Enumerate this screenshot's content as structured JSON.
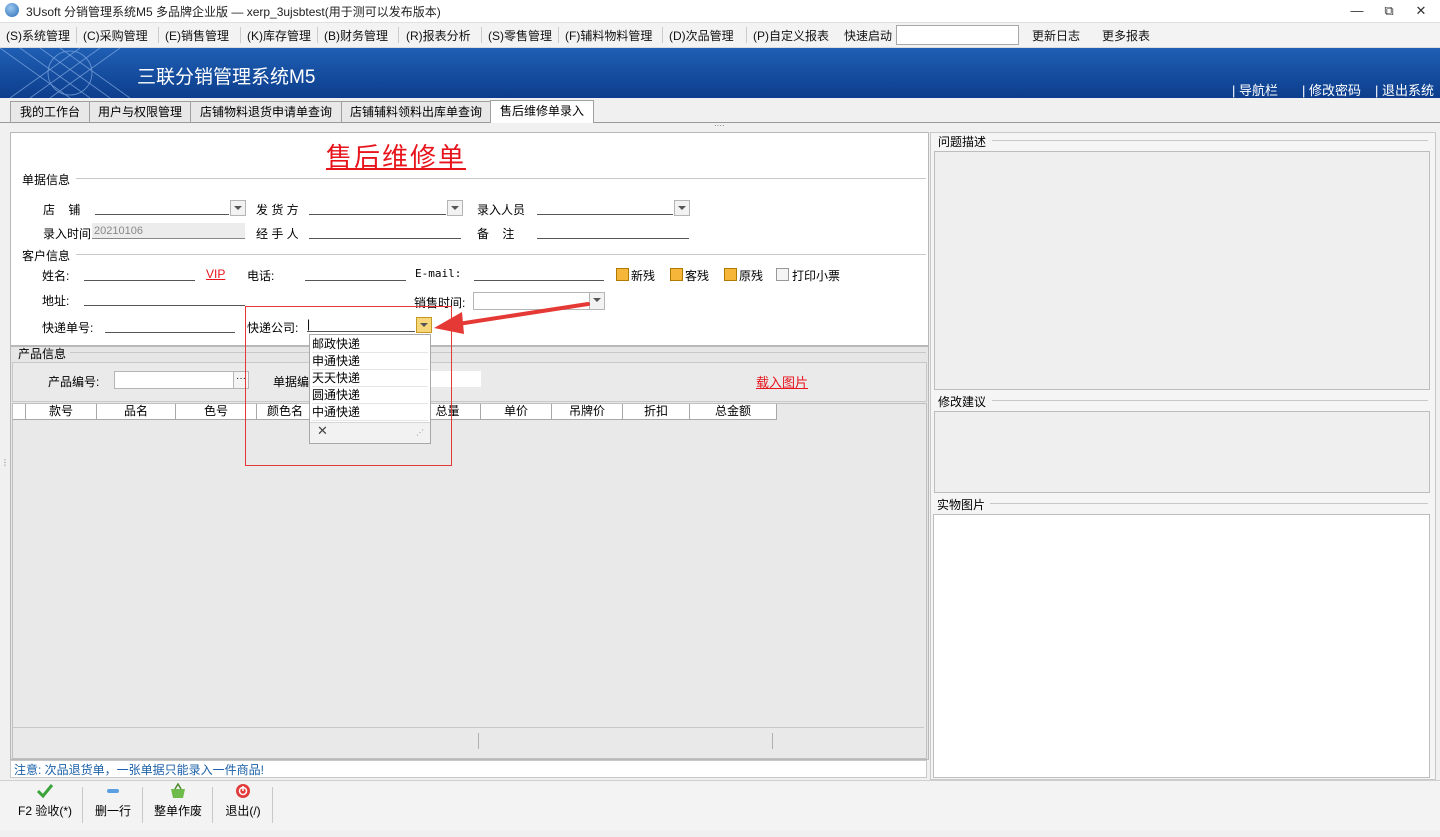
{
  "window": {
    "title": "3Usoft 分销管理系统M5 多品牌企业版 — xerp_3ujsbtest(用于测可以发布版本)",
    "controls": [
      "—",
      "⧉",
      "✕"
    ]
  },
  "menu": {
    "items": [
      "(S)系统管理",
      "(C)采购管理",
      "(E)销售管理",
      "(K)库存管理",
      "(B)财务管理",
      "(R)报表分析",
      "(S)零售管理",
      "(F)辅料物料管理",
      "(D)次品管理",
      "(P)自定义报表"
    ],
    "quick_start_label": "快速启动",
    "quick_start_value": "",
    "update_log": "更新日志",
    "more_reports": "更多报表"
  },
  "banner": {
    "brand": "三联分销管理系统M5",
    "links": [
      "导航栏",
      "修改密码",
      "退出系统"
    ]
  },
  "tabs": [
    "我的工作台",
    "用户与权限管理",
    "店铺物料退货申请单查询",
    "店铺辅料领料出库单查询",
    "售后维修单录入"
  ],
  "form": {
    "title": "售后维修单",
    "doc_section": "单据信息",
    "store_label": "店    铺",
    "store_value": "",
    "shipper_label": "发 货 方",
    "shipper_value": "",
    "entry_person_label": "录入人员",
    "entry_person_value": "",
    "entry_time_label": "录入时间",
    "entry_time_value": "20210106",
    "handler_label": "经 手 人",
    "handler_value": "",
    "remark_label": "备    注",
    "remark_value": "",
    "customer_section": "客户信息",
    "name_label": "姓名:",
    "vip_link": "VIP",
    "phone_label": "电话:",
    "email_label": "E-mail:",
    "checkboxes": [
      {
        "label": "新残",
        "checked": true
      },
      {
        "label": "客残",
        "checked": true
      },
      {
        "label": "原残",
        "checked": true
      },
      {
        "label": "打印小票",
        "checked": false
      }
    ],
    "address_label": "地址:",
    "sale_time_label": "销售时间:",
    "express_no_label": "快递单号:",
    "express_company_label": "快递公司:",
    "express_company_value": "|"
  },
  "express_options": [
    "邮政快递",
    "申通快递",
    "天天快递",
    "圆通快递",
    "中通快递"
  ],
  "product": {
    "section": "产品信息",
    "code_label": "产品编号:",
    "doc_no_label": "单据编",
    "load_image": "载入图片",
    "columns": [
      "款号",
      "品名",
      "色号",
      "颜色名",
      "",
      "总量",
      "单价",
      "吊牌价",
      "折扣",
      "总金额"
    ]
  },
  "note": "注意: 次品退货单，一张单据只能录入一件商品!",
  "right_panel": {
    "problem_label": "问题描述",
    "suggestion_label": "修改建议",
    "photo_label": "实物图片"
  },
  "toolbar": {
    "buttons": [
      "F2 验收(*)",
      "删一行",
      "整单作废",
      "退出(/)"
    ]
  },
  "colors": {
    "banner": "#1a52a8",
    "title_red": "#e8141c",
    "note_blue": "#1a5fa8",
    "arrow_red": "#e53935"
  }
}
